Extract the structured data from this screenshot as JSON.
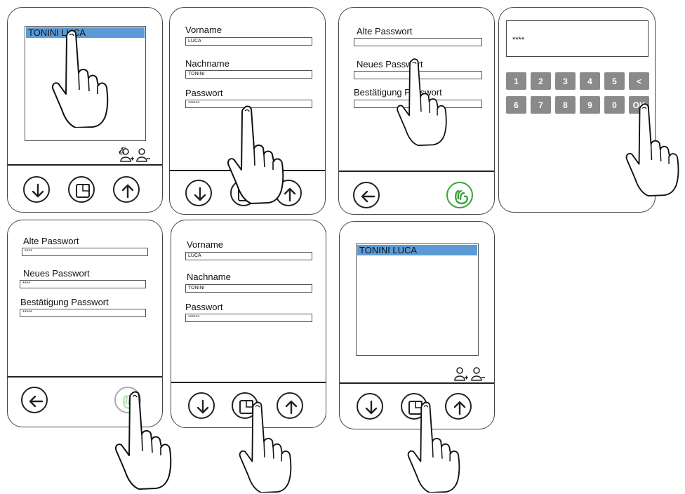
{
  "user_list": {
    "selected_user": "TONINI LUCA"
  },
  "user_form": {
    "first_name_label": "Vorname",
    "first_name_value": "LUCA",
    "last_name_label": "Nachname",
    "last_name_value": "TONINI",
    "password_label": "Passwort",
    "password_value": "******"
  },
  "change_password": {
    "old_label": "Alte Passwort",
    "new_label": "Neues Passwort",
    "confirm_label": "Bestätigung Passwort",
    "old_value": "****",
    "new_value": "****",
    "confirm_value": "*****"
  },
  "keypad": {
    "display_value": "****",
    "keys_row1": [
      "1",
      "2",
      "3",
      "4",
      "5",
      "<"
    ],
    "keys_row2": [
      "6",
      "7",
      "8",
      "9",
      "0",
      "OK"
    ]
  },
  "icons": {
    "user_add": "user-add-icon",
    "user_remove": "user-remove-icon",
    "down": "arrow-down-icon",
    "up": "arrow-up-icon",
    "edit": "edit-icon",
    "back": "arrow-left-icon",
    "confirm": "hand-confirm-icon"
  },
  "colors": {
    "selection": "#5b9bd5",
    "confirm_green": "#3aa33a",
    "key_gray": "#8a8a8a"
  }
}
